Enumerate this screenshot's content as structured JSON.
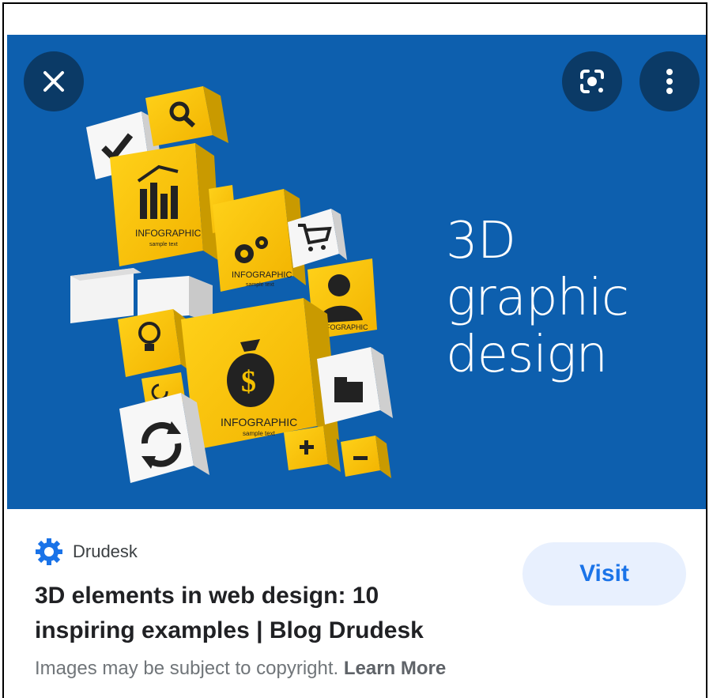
{
  "controls": {
    "close_icon": "close-icon",
    "lens_icon": "google-lens-icon",
    "more_icon": "more-vert-icon"
  },
  "hero": {
    "title_lines": [
      "3D",
      "graphic",
      "design"
    ],
    "cube_labels": {
      "infographic": "INFOGRAPHIC",
      "sample": "sample text"
    },
    "colors": {
      "background": "#0d5fae",
      "cube_yellow": "#f5c000",
      "cube_white": "#eeeeee"
    }
  },
  "result": {
    "source_name": "Drudesk",
    "source_icon": "gear-icon",
    "title": "3D elements in web design: 10 inspiring examples | Blog Drudesk",
    "visit_label": "Visit",
    "copyright_text": "Images may be subject to copyright.",
    "learn_more": "Learn More",
    "colors": {
      "accent": "#1a73e8",
      "visit_bg": "#e8f0fe"
    }
  }
}
